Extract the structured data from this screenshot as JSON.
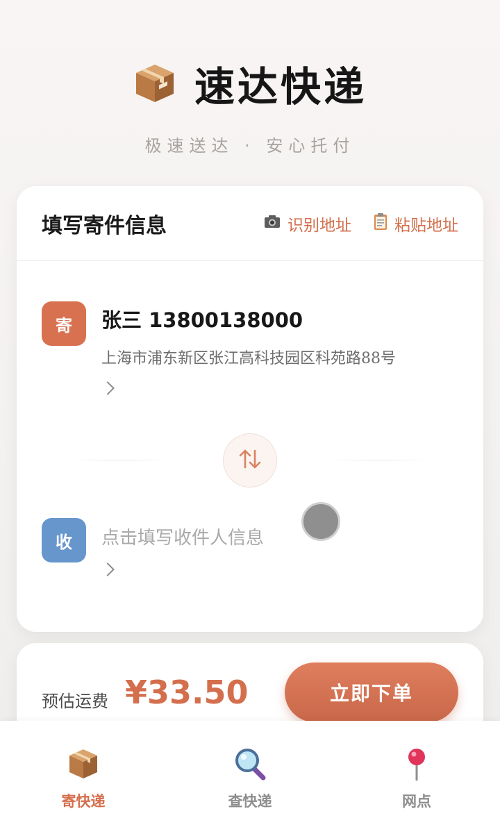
{
  "header": {
    "title": "速达快递",
    "subtitle": "极速送达 · 安心托付",
    "logo_icon": "package-icon"
  },
  "form": {
    "title": "填写寄件信息",
    "actions": [
      {
        "label": "识别地址",
        "icon": "camera-icon"
      },
      {
        "label": "粘贴地址",
        "icon": "clipboard-icon"
      }
    ],
    "sender": {
      "badge": "寄",
      "name_phone": "张三 13800138000",
      "address": "上海市浦东新区张江高科技园区科苑路88号"
    },
    "receiver": {
      "badge": "收",
      "placeholder": "点击填写收件人信息"
    },
    "swap_icon": "swap-arrows-icon"
  },
  "order": {
    "price_label": "预估运费",
    "price_value": "¥33.50",
    "button_label": "立即下单"
  },
  "nav": [
    {
      "label": "寄快递",
      "icon": "package-icon",
      "active": true
    },
    {
      "label": "查快递",
      "icon": "magnifier-icon",
      "active": false
    },
    {
      "label": "网点",
      "icon": "pin-icon",
      "active": false
    }
  ],
  "colors": {
    "accent": "#d46f4d",
    "sender_badge": "#d8714f",
    "receiver_badge": "#6796cc"
  }
}
